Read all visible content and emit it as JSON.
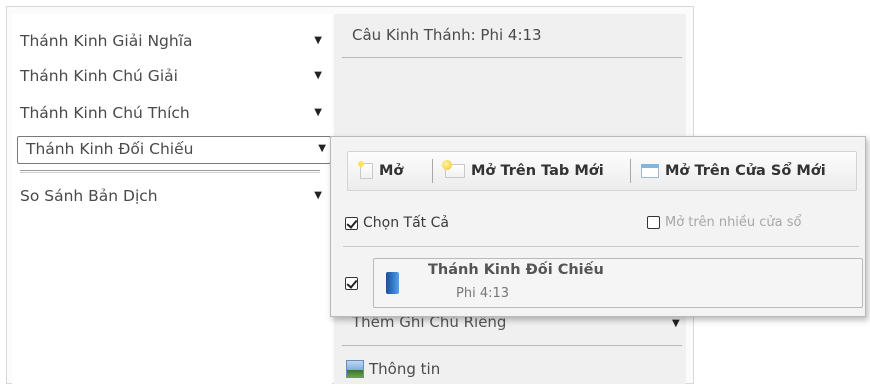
{
  "left_menu": {
    "items": [
      {
        "label": "Thánh Kinh Giải Nghĩa",
        "arrow": "▼"
      },
      {
        "label": "Thánh Kinh Chú Giải",
        "arrow": "▼"
      },
      {
        "label": "Thánh Kinh Chú Thích",
        "arrow": "▼"
      },
      {
        "label": "Thánh Kinh Đối Chiếu",
        "arrow": "▼"
      },
      {
        "label": "So Sánh Bản Dịch",
        "arrow": "▼"
      }
    ]
  },
  "right_panel": {
    "title": "Câu Kinh Thánh: Phi 4:13",
    "partial_dropdown": "Thêm Ghi Chú Riêng",
    "partial_arrow": "▼",
    "info_label": "Thông tin"
  },
  "popup": {
    "toolbar": {
      "open_label": "Mở",
      "open_new_tab_label": "Mở Trên Tab Mới",
      "open_new_window_label": "Mở Trên Cửa Sổ Mới"
    },
    "select_all_label": "Chọn Tất Cả",
    "select_all_checked": true,
    "multi_window_label": "Mở trên nhiều cửa sổ",
    "multi_window_checked": false,
    "results": [
      {
        "title": "Thánh Kinh Đối Chiếu",
        "subtitle": "Phi 4:13",
        "checked": true,
        "icon": "book-icon"
      }
    ]
  },
  "colors": {
    "panel_bg": "#f0f0f0",
    "popup_bg": "#f3f3f3",
    "book_blue": "#2e72c6"
  }
}
